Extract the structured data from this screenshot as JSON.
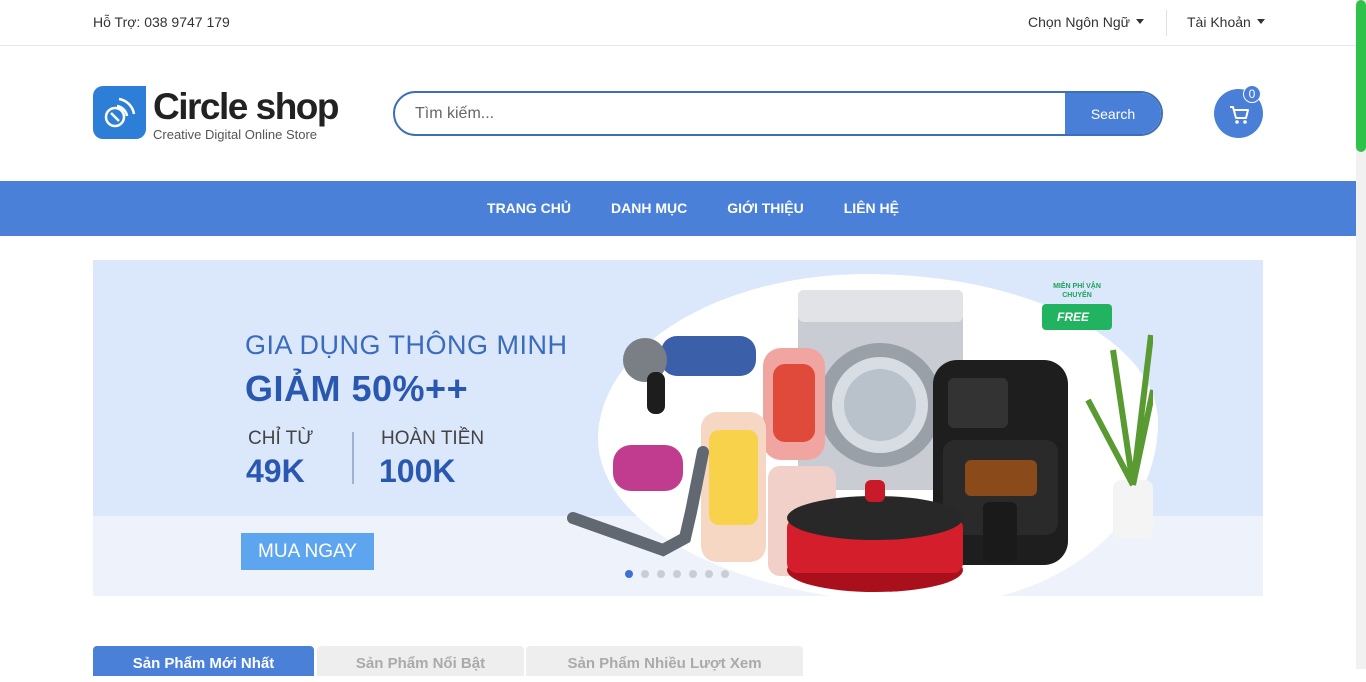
{
  "topbar": {
    "support": "Hỗ Trợ: 038 9747 179",
    "language": "Chọn Ngôn Ngữ",
    "account": "Tài Khoản"
  },
  "brand": {
    "name": "Circle shop",
    "tagline": "Creative Digital Online Store"
  },
  "search": {
    "placeholder": "Tìm kiếm...",
    "button": "Search"
  },
  "cart": {
    "count": "0"
  },
  "nav": {
    "items": [
      "TRANG CHỦ",
      "DANH MỤC",
      "GIỚI THIỆU",
      "LIÊN HỆ"
    ]
  },
  "banner": {
    "title_line1": "GIA DỤNG THÔNG MINH",
    "title_line2": "GIẢM 50%++",
    "from_label": "CHỈ TỪ",
    "from_value": "49K",
    "refund_label": "HOÀN TIỀN",
    "refund_value": "100K",
    "cta": "MUA NGAY",
    "badge_top": "MIỄN PHÍ VẬN CHUYỂN",
    "badge_free": "FREE",
    "slides_total": 7,
    "active_slide": 1
  },
  "tabs": [
    "Sản Phẩm Mới Nhất",
    "Sản Phẩm Nổi Bật",
    "Sản Phẩm Nhiều Lượt Xem"
  ],
  "colors": {
    "accent": "#4a80d8",
    "scroll_thumb": "#2fc24a"
  }
}
